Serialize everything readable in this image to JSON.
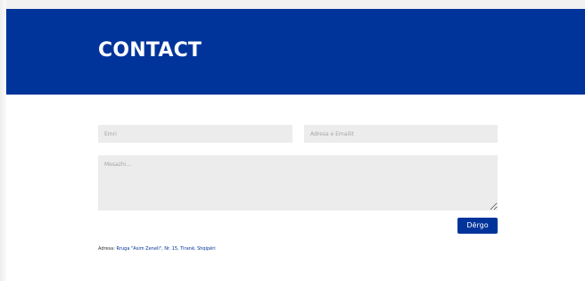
{
  "hero": {
    "title": "CONTACT",
    "background_color": "#01349b",
    "text_color": "#ffffff"
  },
  "form": {
    "name_placeholder": "Emri",
    "email_placeholder": "Adresa e Emailit",
    "message_placeholder": "Mesazhi...",
    "submit_label": "Dërgo",
    "field_background": "#ececec"
  },
  "address": {
    "label": "Adresa:",
    "value": "Rruga \"Asim Zeneli\", Nr. 15, Tiranë, Shqipëri"
  }
}
